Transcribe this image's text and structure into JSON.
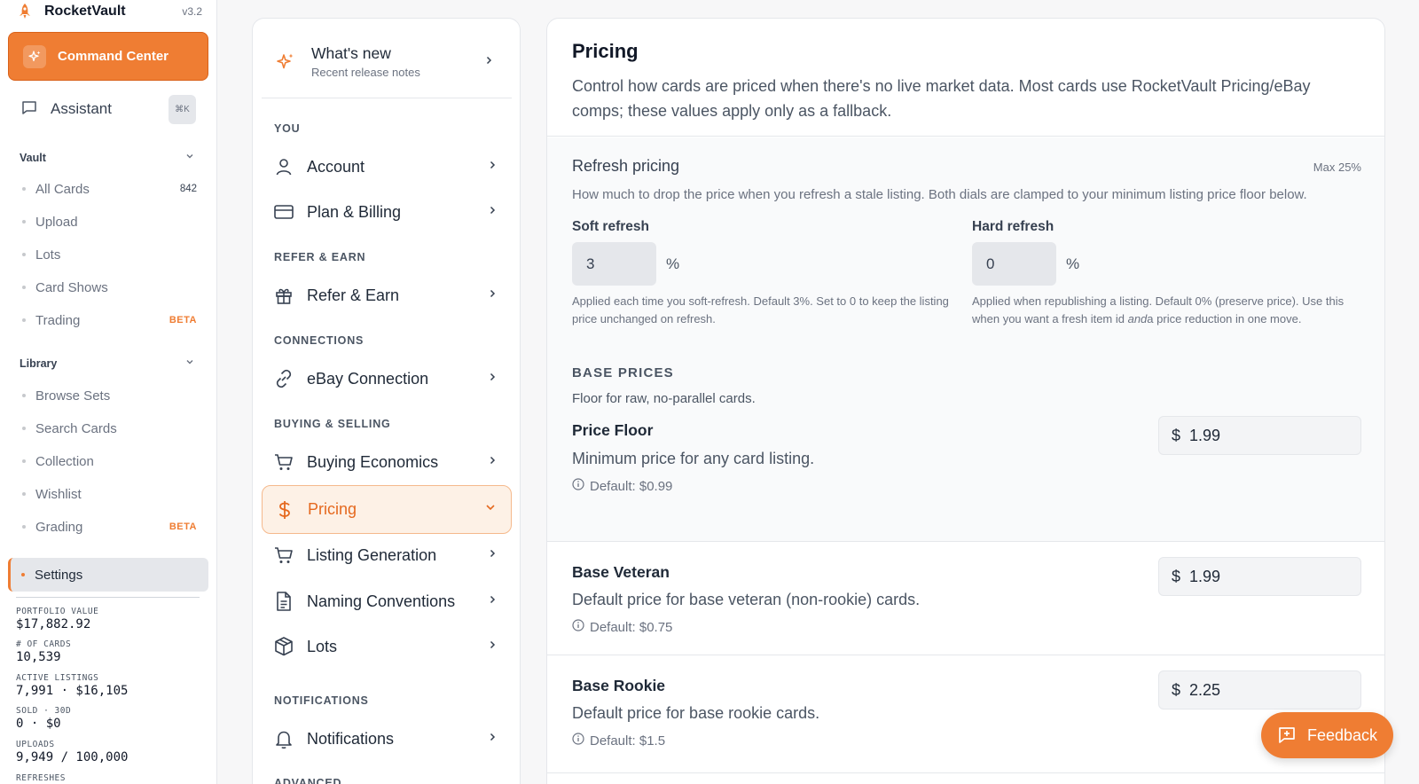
{
  "brand": {
    "name": "RocketVault",
    "version": "v3.2"
  },
  "sidebar": {
    "command_center": "Command Center",
    "assistant": {
      "label": "Assistant",
      "shortcut": "⌘K"
    },
    "vault": {
      "title": "Vault",
      "items": [
        {
          "label": "All Cards",
          "count": "842"
        },
        {
          "label": "Upload"
        },
        {
          "label": "Lots"
        },
        {
          "label": "Card Shows"
        },
        {
          "label": "Trading",
          "badge": "BETA"
        }
      ]
    },
    "library": {
      "title": "Library",
      "items": [
        {
          "label": "Browse Sets"
        },
        {
          "label": "Search Cards"
        },
        {
          "label": "Collection"
        },
        {
          "label": "Wishlist"
        },
        {
          "label": "Grading",
          "badge": "BETA"
        }
      ]
    },
    "settings": "Settings",
    "stats": [
      {
        "label": "PORTFOLIO VALUE",
        "value": "$17,882.92"
      },
      {
        "label": "# OF CARDS",
        "value": "10,539"
      },
      {
        "label": "ACTIVE LISTINGS",
        "value": "7,991 · $16,105"
      },
      {
        "label": "SOLD · 30D",
        "value": "0 · $0"
      },
      {
        "label": "UPLOADS",
        "value": "9,949 / 100,000"
      },
      {
        "label": "REFRESHES",
        "value": ""
      }
    ]
  },
  "settings_nav": {
    "whats_new": {
      "title": "What's new",
      "subtitle": "Recent release notes"
    },
    "groups": {
      "you": "YOU",
      "refer": "REFER & EARN",
      "connections": "CONNECTIONS",
      "buying_selling": "BUYING & SELLING",
      "notifications": "NOTIFICATIONS",
      "advanced": "ADVANCED"
    },
    "items": {
      "account": "Account",
      "plan_billing": "Plan & Billing",
      "refer_earn": "Refer & Earn",
      "ebay": "eBay Connection",
      "buying_economics": "Buying Economics",
      "pricing": "Pricing",
      "listing_generation": "Listing Generation",
      "naming": "Naming Conventions",
      "lots": "Lots",
      "notifications": "Notifications"
    }
  },
  "pricing": {
    "title": "Pricing",
    "subtitle": "Control how cards are priced when there's no live market data. Most cards use RocketVault Pricing/eBay comps; these values apply only as a fallback.",
    "refresh": {
      "title": "Refresh pricing",
      "max": "Max 25%",
      "description": "How much to drop the price when you refresh a stale listing. Both dials are clamped to your minimum listing price floor below.",
      "soft": {
        "label": "Soft refresh",
        "value": "3",
        "unit": "%",
        "help": "Applied each time you soft-refresh. Default 3%. Set to 0 to keep the listing price unchanged on refresh."
      },
      "hard": {
        "label": "Hard refresh",
        "value": "0",
        "unit": "%",
        "help_before": "Applied when republishing a listing. Default 0% (preserve price). Use this when you want a fresh item id ",
        "help_em": "and",
        "help_after": "a price reduction in one move."
      }
    },
    "base_prices": {
      "heading": "BASE PRICES",
      "subtitle": "Floor for raw, no-parallel cards.",
      "rows": [
        {
          "title": "Price Floor",
          "description": "Minimum price for any card listing.",
          "default": "Default: $0.99",
          "currency": "$",
          "value": "1.99"
        },
        {
          "title": "Base Veteran",
          "description": "Default price for base veteran (non-rookie) cards.",
          "default": "Default: $0.75",
          "currency": "$",
          "value": "1.99"
        },
        {
          "title": "Base Rookie",
          "description": "Default price for base rookie cards.",
          "default": "Default: $1.5",
          "currency": "$",
          "value": "2.25"
        }
      ]
    }
  },
  "feedback": "Feedback",
  "colors": {
    "accent": "#ef7d33",
    "active_bg": "#fdf1e6"
  }
}
